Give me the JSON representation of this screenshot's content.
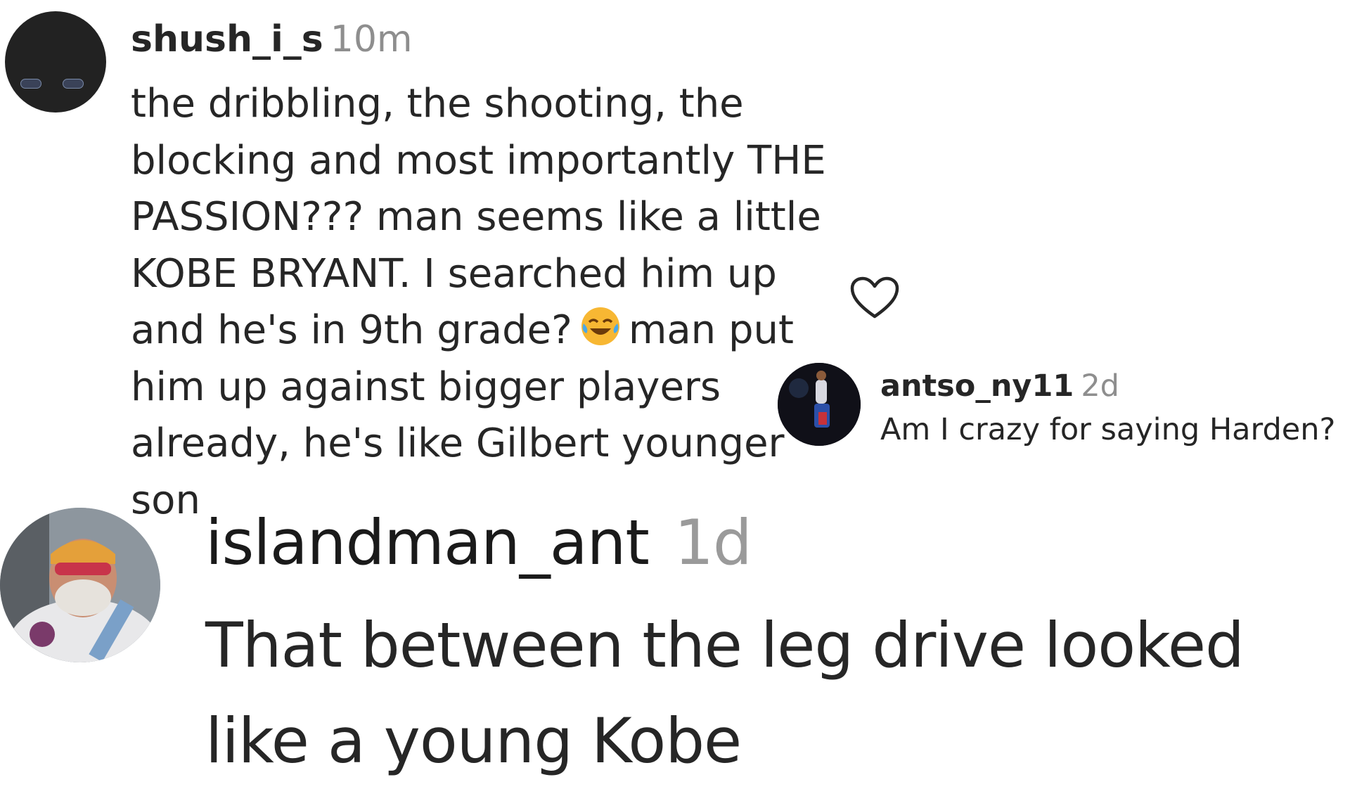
{
  "comments": [
    {
      "username": "shush_i_s",
      "time": "10m",
      "text_before_emoji": "the dribbling, the shooting, the blocking and most importantly THE PASSION??? man seems like a little KOBE BRYANT. I searched him up and he's in 9th grade?",
      "emoji": "face-with-tears-of-joy",
      "text_after_emoji": "man put him up against bigger players already, he's like Gilbert younger son",
      "like_icon": "heart-outline-icon"
    },
    {
      "username": "antso_ny11",
      "time": "2d",
      "text": "Am I crazy for saying Harden?"
    },
    {
      "username": "islandman_ant",
      "time": "1d",
      "text": "That between the leg drive looked like a young Kobe"
    }
  ],
  "colors": {
    "username": "#262626",
    "timestamp": "#8e8e8e",
    "text": "#262626"
  }
}
